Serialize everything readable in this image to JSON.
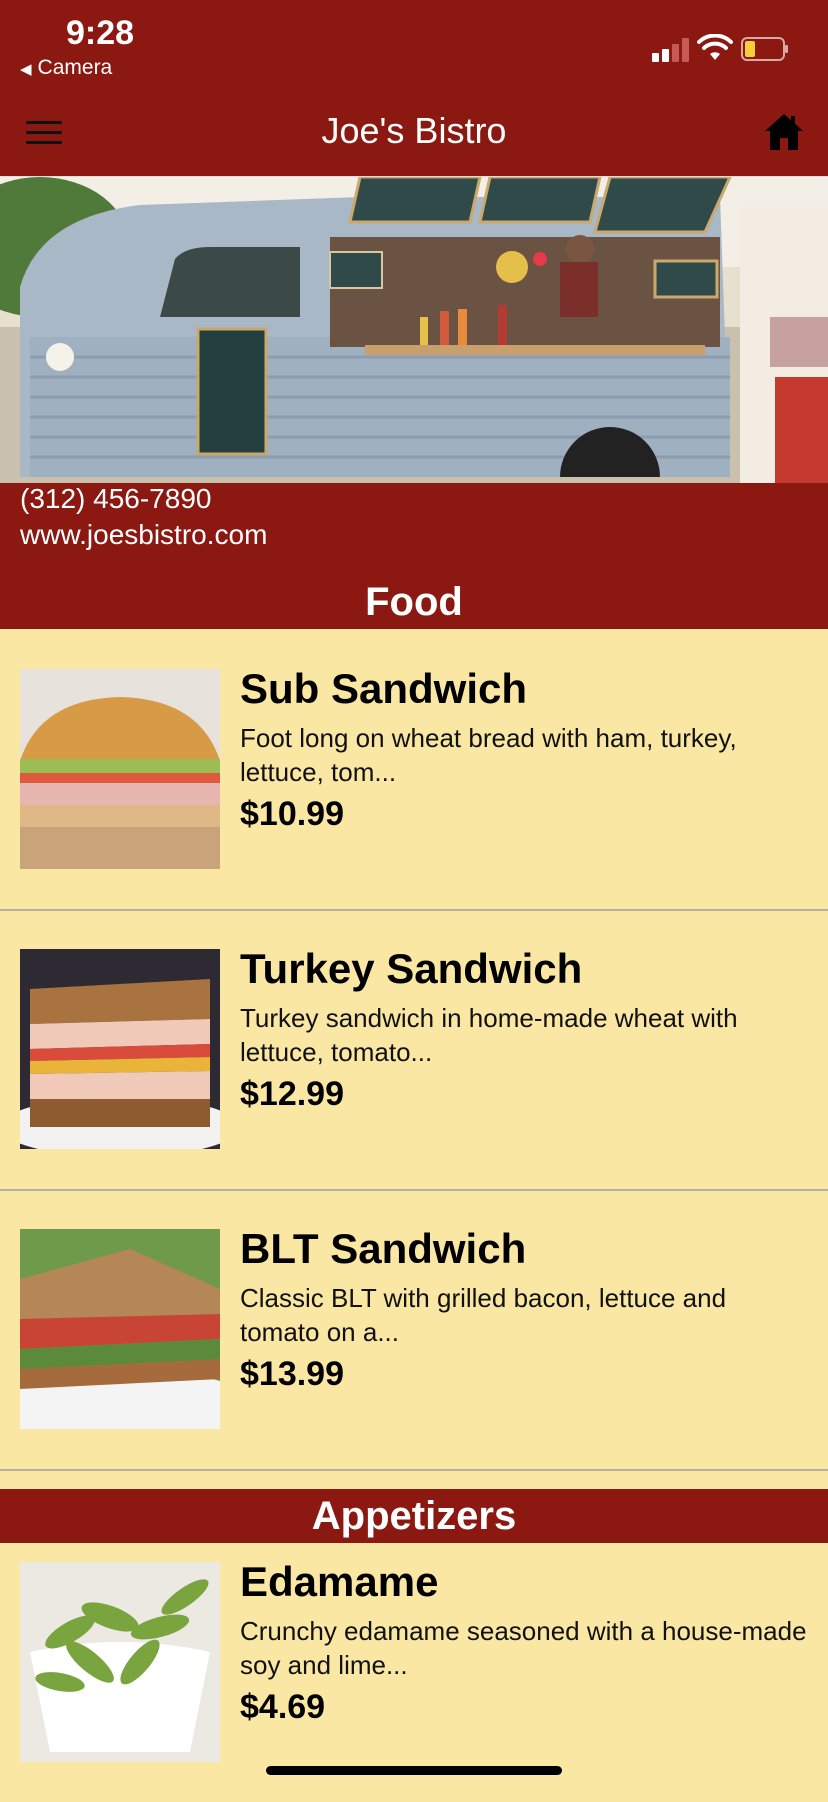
{
  "status_bar": {
    "time": "9:28",
    "back_app": "Camera"
  },
  "navbar": {
    "title": "Joe's Bistro",
    "menu_icon": "hamburger-menu-icon",
    "home_icon": "home-icon"
  },
  "hero": {
    "phone": "(312) 456-7890",
    "website": "www.joesbistro.com"
  },
  "sections": [
    {
      "title": "Food",
      "items": [
        {
          "name": "Sub Sandwich",
          "description": "Foot long on wheat bread with ham, turkey, lettuce, tom...",
          "price": "$10.99"
        },
        {
          "name": "Turkey Sandwich",
          "description": "Turkey sandwich in home-made wheat with lettuce, tomato...",
          "price": "$12.99"
        },
        {
          "name": "BLT Sandwich",
          "description": "Classic BLT with grilled bacon, lettuce and tomato on a...",
          "price": "$13.99"
        }
      ]
    },
    {
      "title": "Appetizers",
      "items": [
        {
          "name": "Edamame",
          "description": "Crunchy edamame seasoned with a house-made soy and lime...",
          "price": "$4.69"
        }
      ]
    }
  ],
  "colors": {
    "brand_red": "#8b1811",
    "menu_background": "#fbe7a4"
  }
}
